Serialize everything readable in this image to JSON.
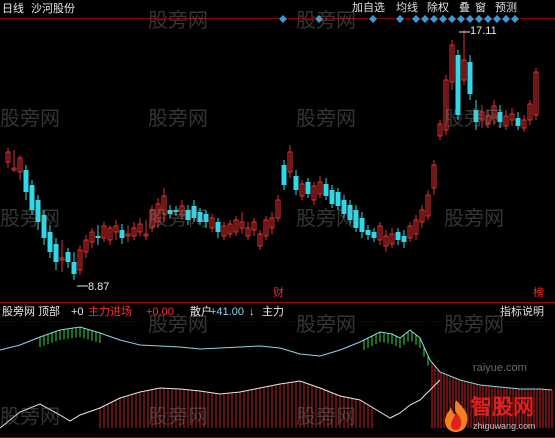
{
  "header": {
    "period_label": "日线",
    "stock_name": "沙河股份",
    "toolbar": [
      "加自选",
      "均线",
      "除权",
      "叠",
      "窗",
      "预测"
    ]
  },
  "main_chart": {
    "high_label": "17.11",
    "low_label": "8.87",
    "event_markers": [
      "财",
      "榜"
    ]
  },
  "indicator": {
    "title": "股旁网 顶部",
    "value_label": "+0",
    "main_entry_label": "主力进场",
    "main_entry_value": "+0.00",
    "retail_label": "散户",
    "retail_value": "+41.00",
    "retail_arrow": "↓",
    "main_label": "主力",
    "explain_button": "指标说明"
  },
  "watermark": "股旁网",
  "brand": {
    "name": "智股网",
    "url": "zhiguwang.com",
    "footer_url": "raiyue.com"
  },
  "colors": {
    "background": "#000000",
    "up": "#e03030",
    "down": "#30d8e8",
    "accent_red": "#ff2020",
    "diamond": "#3a9ad8",
    "indicator_green": "#30e030",
    "indicator_line": "#8ad8e8"
  }
}
